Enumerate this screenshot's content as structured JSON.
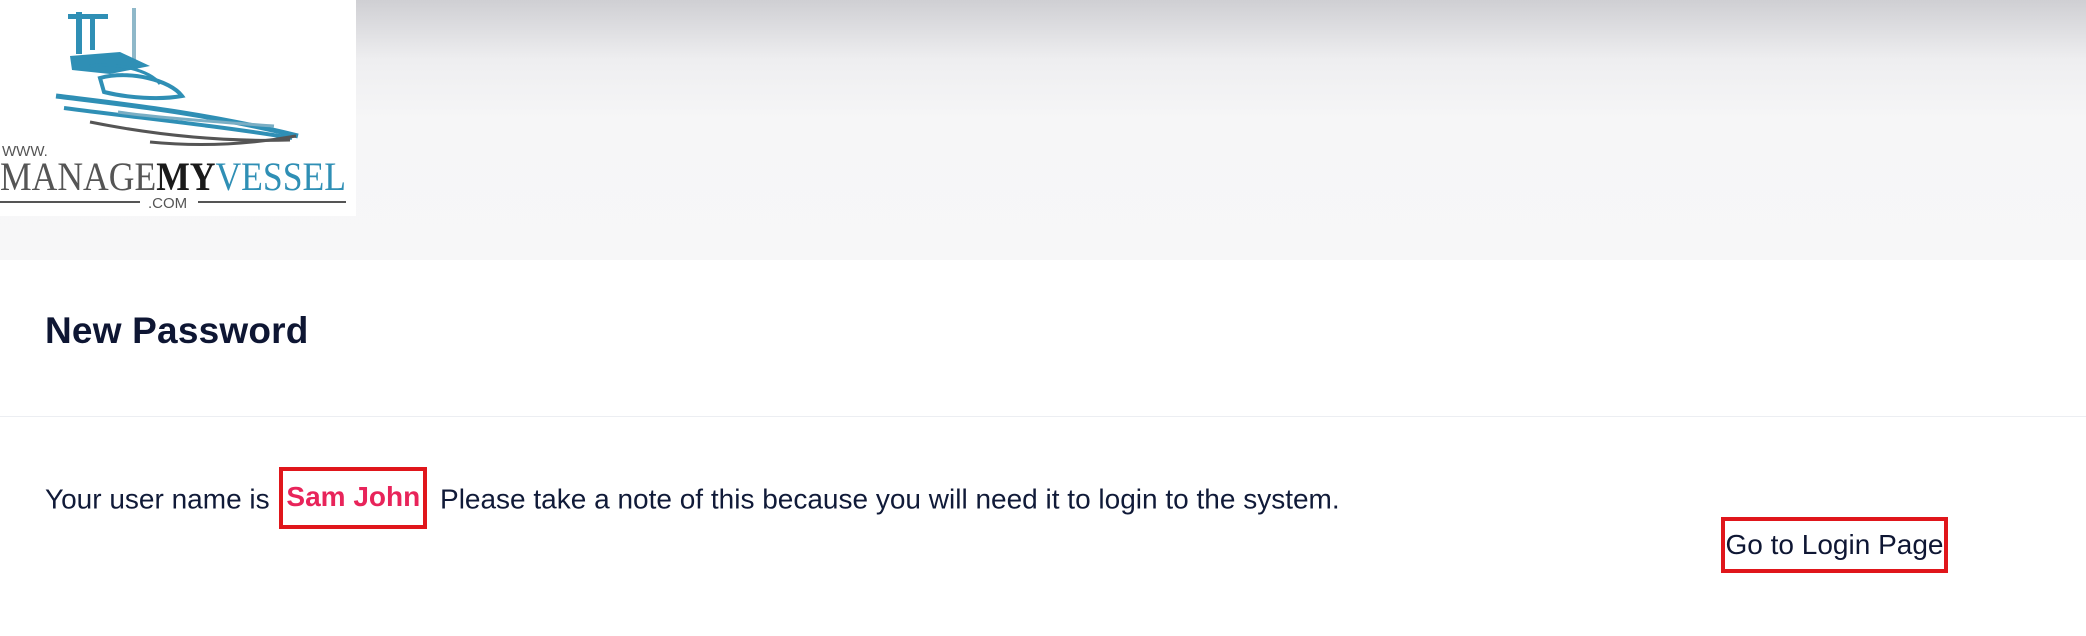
{
  "header": {
    "logo": {
      "prefix": "WWW.",
      "word_manage": "MANAGE",
      "word_my": "MY",
      "word_vessel": "VESSEL",
      "suffix": ".COM"
    }
  },
  "page": {
    "title": "New Password"
  },
  "message": {
    "before": "Your user name is ",
    "username": "Sam John",
    "after": " Please take a note of this because you will need it to login to the system."
  },
  "actions": {
    "go_to_login": "Go to Login Page"
  },
  "colors": {
    "username": "#e8245a",
    "highlight_border": "#e0161b",
    "logo_blue": "#2f8fb5",
    "logo_gray": "#555555"
  }
}
